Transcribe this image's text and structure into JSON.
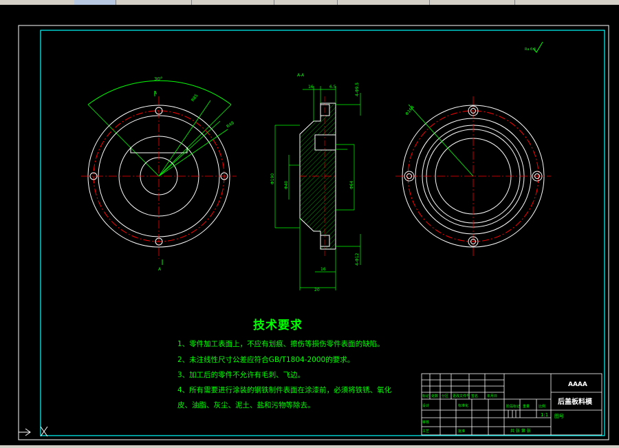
{
  "tech_requirements": {
    "title": "技术要求",
    "items": [
      "1、零件加工表面上，不应有划痕、擦伤等损伤零件表面的缺陷。",
      "2、未注线性尺寸公差应符合GB/T1804-2000的要求。",
      "3、加工后的零件不允许有毛刺、飞边。",
      "4、所有需要进行涂装的钢铁制件表面在涂漆前，必须将铁锈、氧化",
      "皮、油脂、灰尘、泥土、盐和污物等除去。"
    ]
  },
  "title_block": {
    "drawing_code": "AAAA",
    "part_name": "后盖板料模",
    "scale": "1:1",
    "drawing_no_label": "图号",
    "sheet_label": "共 张 第 张"
  },
  "dimensions": {
    "angle_top": "30°",
    "r_outer": "R85",
    "r_inner": "R48",
    "section_label": "A-A",
    "dia_outer_left": "Φ190",
    "dia_mid_left": "Φ40",
    "dia_right": "Φ64",
    "dim_16": "16",
    "dim_6": "6.5",
    "dim_20": "20",
    "hole_top": "4-Φ9.5",
    "hole_bottom": "4-Φ12",
    "dia_right_view": "Φ164",
    "roughness": "Ra 6.3"
  },
  "colors": {
    "background": "#000000",
    "frame": "#ffffff",
    "inner_frame": "#00ffff",
    "centerline": "#ff0000",
    "dimension": "#00ff00",
    "text": "#00ff00"
  }
}
